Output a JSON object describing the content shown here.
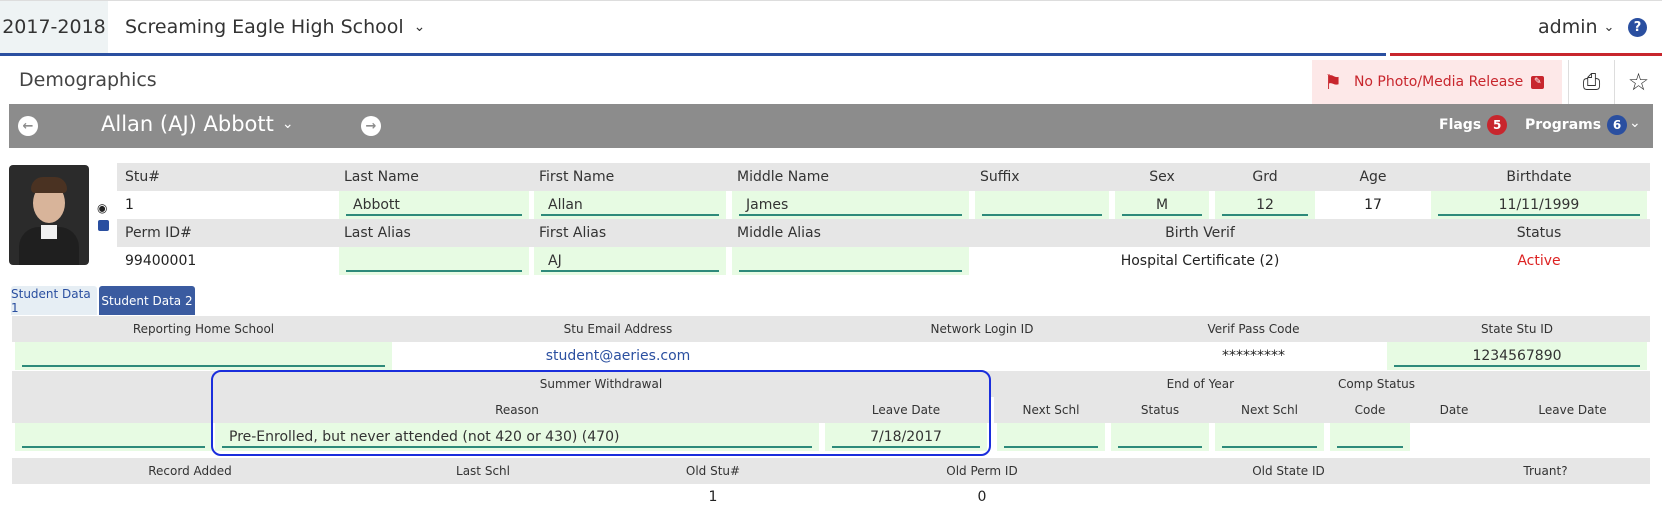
{
  "topbar": {
    "year": "2017-2018",
    "school": "Screaming Eagle High School",
    "user": "admin",
    "help_glyph": "?"
  },
  "page": {
    "title": "Demographics",
    "photo_release": "No Photo/Media Release"
  },
  "student": {
    "name": "Allan (AJ) Abbott",
    "flags_label": "Flags",
    "flags_count": "5",
    "programs_label": "Programs",
    "programs_count": "6"
  },
  "info": {
    "headers1": {
      "stu": "Stu#",
      "last": "Last Name",
      "first": "First Name",
      "middle": "Middle Name",
      "suffix": "Suffix",
      "sex": "Sex",
      "grd": "Grd",
      "age": "Age",
      "birthdate": "Birthdate"
    },
    "values1": {
      "stu": "1",
      "last": "Abbott",
      "first": "Allan",
      "middle": "James",
      "suffix": "",
      "sex": "M",
      "grd": "12",
      "age": "17",
      "birthdate": "11/11/1999"
    },
    "headers2": {
      "perm": "Perm ID#",
      "last_alias": "Last Alias",
      "first_alias": "First Alias",
      "middle_alias": "Middle Alias",
      "birth_verif": "Birth Verif",
      "status": "Status"
    },
    "values2": {
      "perm": "99400001",
      "last_alias": "",
      "first_alias": "AJ",
      "middle_alias": "",
      "birth_verif": "Hospital Certificate (2)",
      "status": "Active"
    }
  },
  "tabs": {
    "tab1": "Student Data 1",
    "tab2": "Student Data 2"
  },
  "data2": {
    "headers": {
      "reporting_home_school": "Reporting Home School",
      "email": "Stu Email Address",
      "network_login": "Network Login ID",
      "verif_pass": "Verif Pass Code",
      "state_stu_id": "State Stu ID"
    },
    "values": {
      "reporting_home_school": "",
      "email": "student@aeries.com",
      "network_login": "",
      "verif_pass": "*********",
      "state_stu_id": "1234567890"
    },
    "group_headers": {
      "summer_withdrawal": "Summer Withdrawal",
      "end_of_year": "End of Year",
      "comp_status": "Comp Status"
    },
    "sub_headers": {
      "reason": "Reason",
      "leave_date": "Leave Date",
      "next_schl": "Next Schl",
      "status": "Status",
      "next_schl2": "Next Schl",
      "code": "Code",
      "date": "Date",
      "leave_date2": "Leave Date"
    },
    "sub_values": {
      "reason": "Pre-Enrolled, but never attended (not 420 or 430) (470)",
      "leave_date": "7/18/2017"
    },
    "bottom_headers": {
      "record_added": "Record Added",
      "last_schl": "Last Schl",
      "old_stu": "Old Stu#",
      "old_perm": "Old Perm ID",
      "old_state": "Old State ID",
      "truant": "Truant?"
    },
    "bottom_values": {
      "old_stu": "1",
      "old_perm": "0"
    }
  },
  "icons": {
    "year_chevron": "chevron-down-icon",
    "left_arrow": "arrow-left-icon",
    "right_arrow": "arrow-right-icon",
    "flag": "flag-icon",
    "print": "print-icon",
    "star": "star-icon"
  },
  "colors": {
    "brand_blue": "#2a4fa0",
    "brand_red": "#c8262d",
    "editable_bg": "#e7fbe3",
    "highlight_box": "#1a2edc"
  }
}
